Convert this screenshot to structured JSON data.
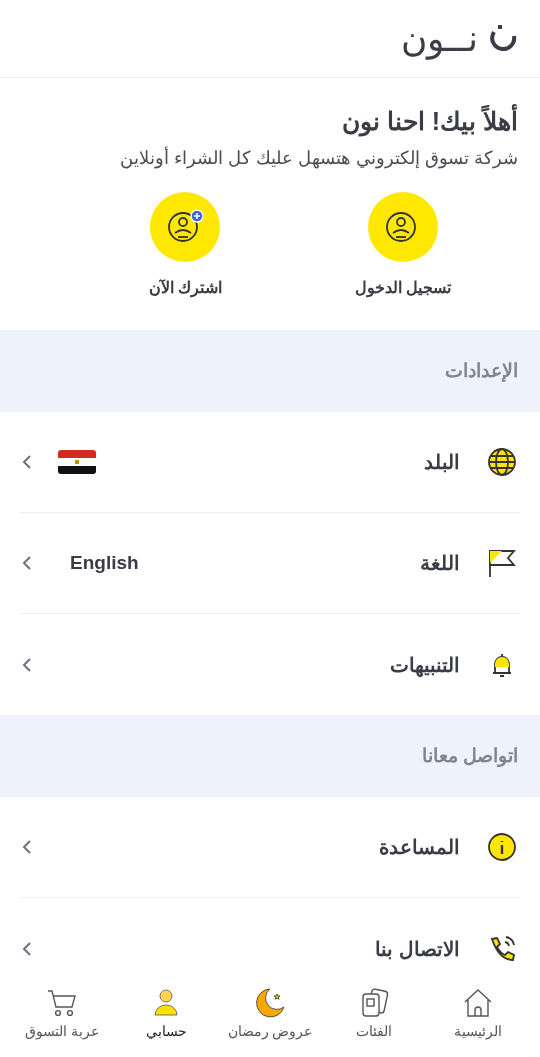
{
  "logo": {
    "text": "نــون"
  },
  "welcome": {
    "title": "أهلاً بيك! احنا نون",
    "subtitle": "شركة تسوق إلكتروني هتسهل عليك كل الشراء أونلاين",
    "actions": [
      {
        "kind": "login",
        "label": "تسجيل الدخول"
      },
      {
        "kind": "signup",
        "label": "اشترك الآن"
      }
    ]
  },
  "sections": [
    {
      "title": "الإعدادات",
      "items": [
        {
          "kind": "country",
          "label": "البلد"
        },
        {
          "kind": "language",
          "label": "اللغة",
          "value": "English"
        },
        {
          "kind": "notifications",
          "label": "التنبيهات"
        }
      ]
    },
    {
      "title": "اتواصل معانا",
      "items": [
        {
          "kind": "help",
          "label": "المساعدة"
        },
        {
          "kind": "contact",
          "label": "الاتصال بنا"
        }
      ]
    }
  ],
  "bottom_nav": [
    {
      "kind": "home",
      "label": "الرئيسية",
      "selected": false
    },
    {
      "kind": "categories",
      "label": "الفئات",
      "selected": false
    },
    {
      "kind": "offers",
      "label": "عروض رمضان",
      "selected": false
    },
    {
      "kind": "account",
      "label": "حسابي",
      "selected": true
    },
    {
      "kind": "cart",
      "label": "عربة التسوق",
      "selected": false
    }
  ]
}
